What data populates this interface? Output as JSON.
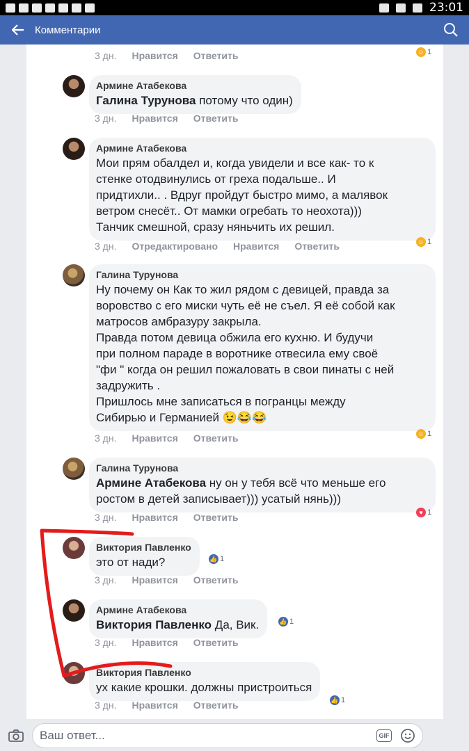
{
  "status_bar": {
    "time": "23:01"
  },
  "app_bar": {
    "title": "Комментарии"
  },
  "meta_labels": {
    "age": "3 дн.",
    "like": "Нравится",
    "reply": "Ответить",
    "edited": "Отредактировано"
  },
  "comments": [
    {
      "author": "Армине Атабекова",
      "mention": "Галина Турунова",
      "text": " потому что один)"
    },
    {
      "author": "Армине Атабекова",
      "lines": [
        "Мои  прям обалдел и, когда увидели и все как- то к",
        "стенке отодвинулись от греха подальше.. И",
        "придтихли.. . Вдруг пройдут быстро  мимо, а малявок",
        "ветром снесёт.. От мамки огребать то неохота)))",
        "Танчик смешной, сразу няньчить их решил."
      ],
      "reaction_count": "1"
    },
    {
      "author": "Галина Турунова",
      "lines": [
        "Ну почему  он Как то жил рядом с девицей, правда за",
        "воровство с его миски  чуть её не съел. Я её собой как",
        "матросов амбразуру  закрыла.",
        "Правда потом девица  обжила  его кухню. И будучи",
        "при полном  параде в воротнике  отвесила  ему  своё",
        "\"фи \" когда он решил пожаловать  в свои пинаты с ней",
        "задружить .",
        "Пришлось мне записаться  в погранцы между",
        "Сибирью  и Германией 😉😂😂"
      ],
      "reaction_count": "1"
    },
    {
      "author": "Галина Турунова",
      "mention": "Армине Атабекова",
      "lines": [
        " ну он у тебя  всё что меньше его",
        "ростом  в детей  записывает))) усатый  нянь)))"
      ],
      "reaction_count": "1"
    },
    {
      "author": "Виктория Павленко",
      "text": "это от нади?",
      "reaction_count": "1"
    },
    {
      "author": "Армине Атабекова",
      "mention": "Виктория Павленко",
      "text": " Да, Вик.",
      "reaction_count": "1"
    },
    {
      "author": "Виктория Павленко",
      "text": "ух какие крошки. должны пристроиться",
      "reaction_count": "1"
    }
  ],
  "top_reaction_count": "1",
  "reply": {
    "placeholder": "Ваш ответ..."
  },
  "icons": [
    "back-arrow-icon",
    "search-icon",
    "camera-icon",
    "gif-icon",
    "emoji-icon",
    "haha-reaction-icon",
    "like-reaction-icon",
    "love-reaction-icon"
  ],
  "colors": {
    "brand": "#4267b2",
    "bubble": "#f2f3f5",
    "annotation": "#e31b1b"
  }
}
